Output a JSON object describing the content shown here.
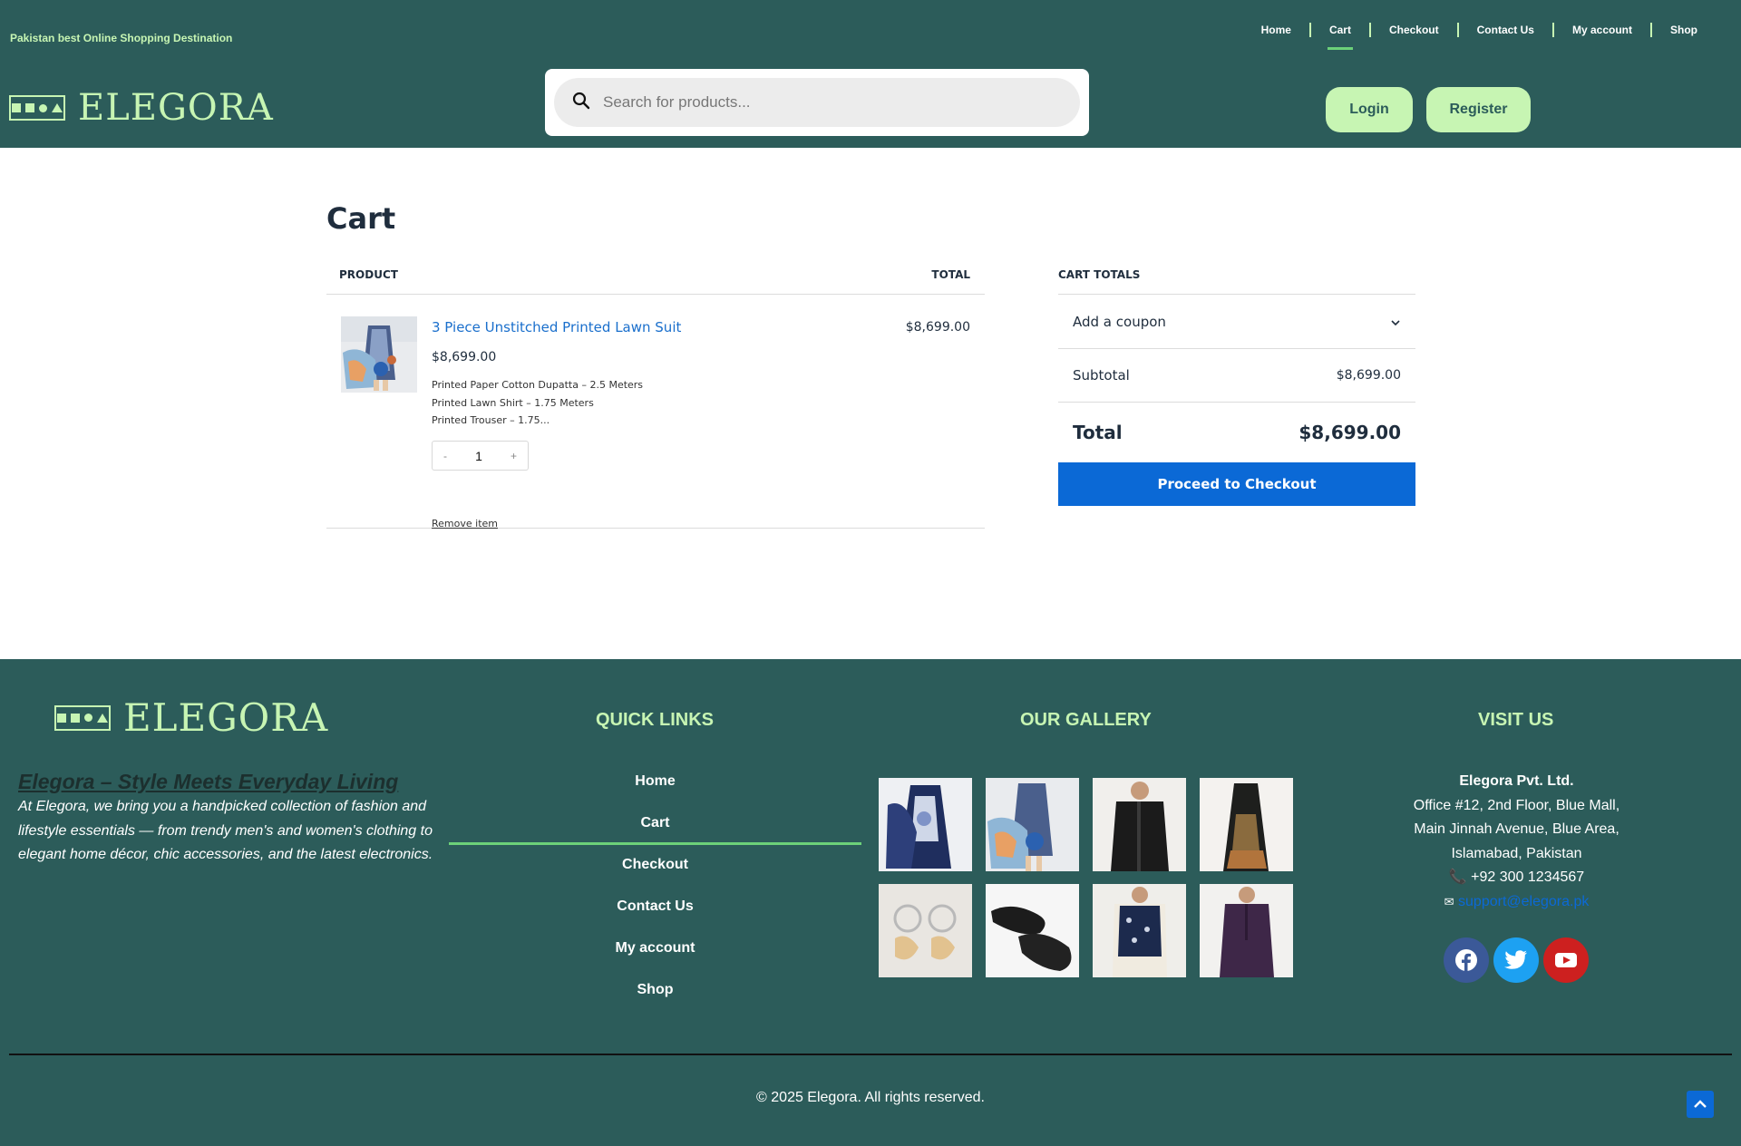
{
  "header": {
    "tagline": "Pakistan best Online Shopping Destination",
    "nav": [
      "Home",
      "Cart",
      "Checkout",
      "Contact Us",
      "My account",
      "Shop"
    ],
    "active_nav": "Cart",
    "logo_text": "ELEGORA",
    "search_placeholder": "Search for products...",
    "login_label": "Login",
    "register_label": "Register"
  },
  "cart": {
    "title": "Cart",
    "col_product": "PRODUCT",
    "col_total": "TOTAL",
    "item": {
      "name": "3 Piece Unstitched Printed Lawn Suit",
      "price": "$8,699.00",
      "meta": [
        "Printed Paper Cotton Dupatta – 2.5 Meters",
        "Printed Lawn Shirt – 1.75 Meters",
        "Printed Trouser – 1.75..."
      ],
      "qty_minus": "-",
      "qty": "1",
      "qty_plus": "+",
      "remove_label": "Remove item",
      "total": "$8,699.00"
    }
  },
  "totals": {
    "heading": "CART TOTALS",
    "coupon_label": "Add a coupon",
    "subtotal_label": "Subtotal",
    "subtotal_value": "$8,699.00",
    "total_label": "Total",
    "total_value": "$8,699.00",
    "checkout_label": "Proceed to Checkout"
  },
  "footer": {
    "logo_text": "ELEGORA",
    "about_title": "Elegora – Style Meets Everyday Living",
    "about_text": "At Elegora, we bring you a handpicked collection of fashion and lifestyle essentials — from trendy men's and women's clothing to elegant home décor, chic accessories, and the latest electronics.",
    "quick_links_heading": "QUICK LINKS",
    "quick_links": [
      "Home",
      "Cart",
      "Checkout",
      "Contact Us",
      "My account",
      "Shop"
    ],
    "gallery_heading": "OUR GALLERY",
    "gallery": [
      "blue embroidered suit",
      "printed lawn suit",
      "black men's jacket",
      "black embroidered dress",
      "silver earrings",
      "black khussa shoes",
      "navy waistcoat",
      "maroon kurta"
    ],
    "visit_heading": "VISIT US",
    "company": "Elegora Pvt. Ltd.",
    "address": [
      "Office #12, 2nd Floor, Blue Mall,",
      "Main Jinnah Avenue, Blue Area,",
      "Islamabad, Pakistan"
    ],
    "phone": "+92 300 1234567",
    "email": "support@elegora.pk",
    "socials": [
      "facebook-icon",
      "twitter-icon",
      "youtube-icon"
    ],
    "copyright": "© 2025 Elegora. All rights reserved."
  },
  "colors": {
    "brand_green": "#2c5c5a",
    "accent_mint": "#c7f5b3",
    "link_blue": "#1a6fcc",
    "button_blue": "#0b69d6",
    "active_underline": "#6cd179"
  }
}
